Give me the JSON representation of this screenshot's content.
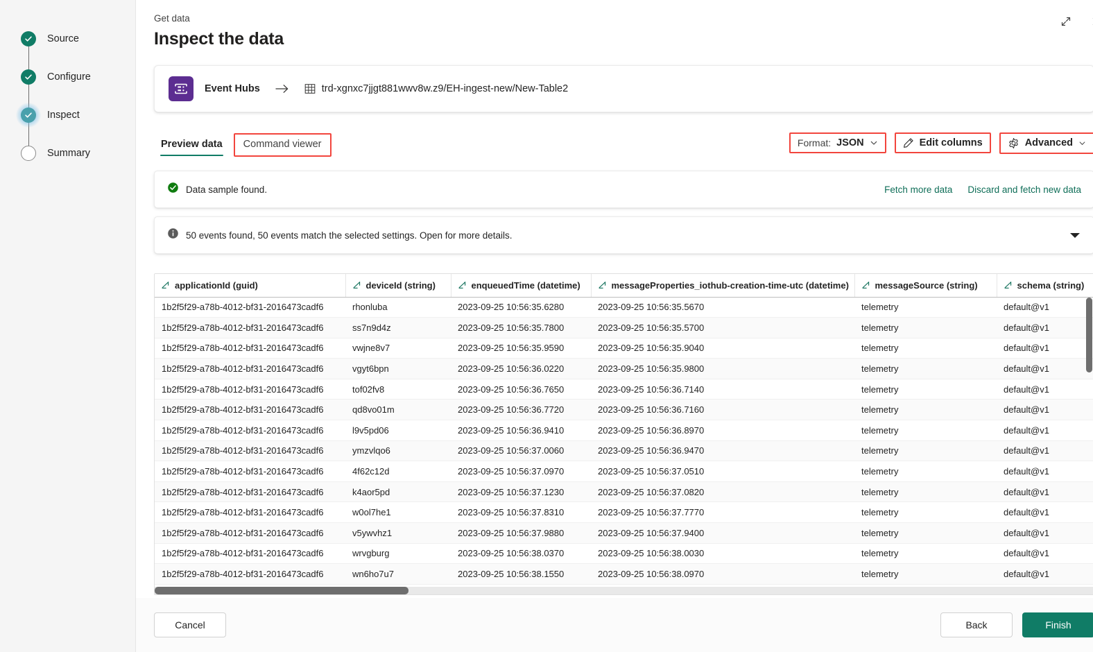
{
  "wizard": {
    "steps": [
      {
        "label": "Source",
        "state": "done"
      },
      {
        "label": "Configure",
        "state": "done"
      },
      {
        "label": "Inspect",
        "state": "current"
      },
      {
        "label": "Summary",
        "state": "pending"
      }
    ]
  },
  "header": {
    "eyebrow": "Get data",
    "title": "Inspect the data",
    "expand_icon": "expand-icon",
    "close_icon": "close-icon"
  },
  "source_card": {
    "icon": "event-hubs-icon",
    "source_label": "Event Hubs",
    "arrow_icon": "arrow-right-icon",
    "table_icon": "table-grid-icon",
    "destination_path": "trd-xgnxc7jjgt881wwv8w.z9/EH-ingest-new/New-Table2"
  },
  "tabs": [
    {
      "label": "Preview data",
      "active": true,
      "highlighted": false
    },
    {
      "label": "Command viewer",
      "active": false,
      "highlighted": true
    }
  ],
  "toolbar": {
    "format_label": "Format:",
    "format_value": "JSON",
    "format_chevron_icon": "chevron-down-icon",
    "edit_columns_label": "Edit columns",
    "edit_columns_icon": "pencil-icon",
    "advanced_label": "Advanced",
    "advanced_icon": "gear-icon",
    "advanced_chevron_icon": "chevron-down-icon",
    "highlight_color": "#f2453d"
  },
  "messages": {
    "success": {
      "icon": "success-check-icon",
      "text": "Data sample found.",
      "links": [
        {
          "label": "Fetch more data"
        },
        {
          "label": "Discard and fetch new data"
        }
      ]
    },
    "info": {
      "icon": "info-icon",
      "text": "50 events found, 50 events match the selected settings. Open for more details.",
      "expand_icon": "chevron-down-filled-icon"
    }
  },
  "table": {
    "columns": [
      {
        "name": "applicationId (guid)",
        "type_icon": "column-type-icon"
      },
      {
        "name": "deviceId (string)",
        "type_icon": "column-type-icon"
      },
      {
        "name": "enqueuedTime (datetime)",
        "type_icon": "column-type-icon"
      },
      {
        "name": "messageProperties_iothub-creation-time-utc (datetime)",
        "type_icon": "column-type-icon"
      },
      {
        "name": "messageSource (string)",
        "type_icon": "column-type-icon"
      },
      {
        "name": "schema (string)",
        "type_icon": "column-type-icon"
      }
    ],
    "rows": [
      [
        "1b2f5f29-a78b-4012-bf31-2016473cadf6",
        "rhonluba",
        "2023-09-25 10:56:35.6280",
        "2023-09-25 10:56:35.5670",
        "telemetry",
        "default@v1"
      ],
      [
        "1b2f5f29-a78b-4012-bf31-2016473cadf6",
        "ss7n9d4z",
        "2023-09-25 10:56:35.7800",
        "2023-09-25 10:56:35.5700",
        "telemetry",
        "default@v1"
      ],
      [
        "1b2f5f29-a78b-4012-bf31-2016473cadf6",
        "vwjne8v7",
        "2023-09-25 10:56:35.9590",
        "2023-09-25 10:56:35.9040",
        "telemetry",
        "default@v1"
      ],
      [
        "1b2f5f29-a78b-4012-bf31-2016473cadf6",
        "vgyt6bpn",
        "2023-09-25 10:56:36.0220",
        "2023-09-25 10:56:35.9800",
        "telemetry",
        "default@v1"
      ],
      [
        "1b2f5f29-a78b-4012-bf31-2016473cadf6",
        "tof02fv8",
        "2023-09-25 10:56:36.7650",
        "2023-09-25 10:56:36.7140",
        "telemetry",
        "default@v1"
      ],
      [
        "1b2f5f29-a78b-4012-bf31-2016473cadf6",
        "qd8vo01m",
        "2023-09-25 10:56:36.7720",
        "2023-09-25 10:56:36.7160",
        "telemetry",
        "default@v1"
      ],
      [
        "1b2f5f29-a78b-4012-bf31-2016473cadf6",
        "l9v5pd06",
        "2023-09-25 10:56:36.9410",
        "2023-09-25 10:56:36.8970",
        "telemetry",
        "default@v1"
      ],
      [
        "1b2f5f29-a78b-4012-bf31-2016473cadf6",
        "ymzvlqo6",
        "2023-09-25 10:56:37.0060",
        "2023-09-25 10:56:36.9470",
        "telemetry",
        "default@v1"
      ],
      [
        "1b2f5f29-a78b-4012-bf31-2016473cadf6",
        "4f62c12d",
        "2023-09-25 10:56:37.0970",
        "2023-09-25 10:56:37.0510",
        "telemetry",
        "default@v1"
      ],
      [
        "1b2f5f29-a78b-4012-bf31-2016473cadf6",
        "k4aor5pd",
        "2023-09-25 10:56:37.1230",
        "2023-09-25 10:56:37.0820",
        "telemetry",
        "default@v1"
      ],
      [
        "1b2f5f29-a78b-4012-bf31-2016473cadf6",
        "w0ol7he1",
        "2023-09-25 10:56:37.8310",
        "2023-09-25 10:56:37.7770",
        "telemetry",
        "default@v1"
      ],
      [
        "1b2f5f29-a78b-4012-bf31-2016473cadf6",
        "v5ywvhz1",
        "2023-09-25 10:56:37.9880",
        "2023-09-25 10:56:37.9400",
        "telemetry",
        "default@v1"
      ],
      [
        "1b2f5f29-a78b-4012-bf31-2016473cadf6",
        "wrvgburg",
        "2023-09-25 10:56:38.0370",
        "2023-09-25 10:56:38.0030",
        "telemetry",
        "default@v1"
      ],
      [
        "1b2f5f29-a78b-4012-bf31-2016473cadf6",
        "wn6ho7u7",
        "2023-09-25 10:56:38.1550",
        "2023-09-25 10:56:38.0970",
        "telemetry",
        "default@v1"
      ]
    ]
  },
  "footer": {
    "cancel_label": "Cancel",
    "back_label": "Back",
    "finish_label": "Finish"
  },
  "colors": {
    "accent_green": "#107c66",
    "link_green": "#0f6e58",
    "eventhubs_purple": "#5c2d91",
    "highlight_red": "#f2453d"
  }
}
